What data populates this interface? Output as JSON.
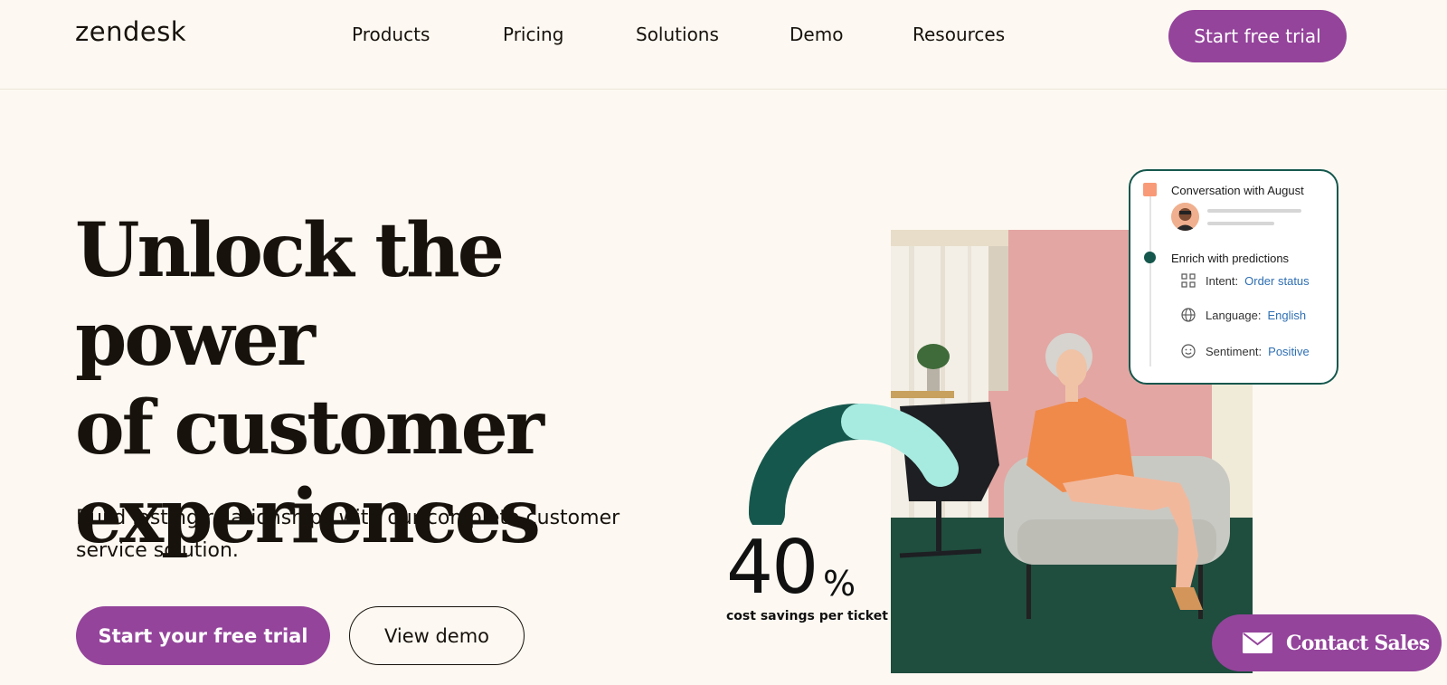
{
  "header": {
    "logo": "zendesk",
    "nav": [
      "Products",
      "Pricing",
      "Solutions",
      "Demo",
      "Resources"
    ],
    "cta": "Start free trial"
  },
  "hero": {
    "headline_lines": [
      "Unlock the power",
      "of customer",
      "experiences"
    ],
    "subhead_lines": [
      "Build lasting relationships with our complete customer",
      "service solution."
    ],
    "primary_cta": "Start your free trial",
    "secondary_cta": "View demo"
  },
  "stat": {
    "value": "40",
    "unit": "%",
    "label": "cost savings per ticket"
  },
  "card": {
    "title": "Conversation with August",
    "enrich": "Enrich with predictions",
    "rows": [
      {
        "label": "Intent:",
        "value": "Order status",
        "icon": "grid-icon"
      },
      {
        "label": "Language:",
        "value": "English",
        "icon": "globe-icon"
      },
      {
        "label": "Sentiment:",
        "value": "Positive",
        "icon": "smiley-icon"
      }
    ]
  },
  "contact": {
    "label": "Contact Sales",
    "icon": "envelope-icon"
  },
  "colors": {
    "brand_purple": "#94449b",
    "background": "#fdf9f2",
    "dark_green": "#15574d",
    "mint": "#a7eae0",
    "link_blue": "#2f6fb3"
  }
}
